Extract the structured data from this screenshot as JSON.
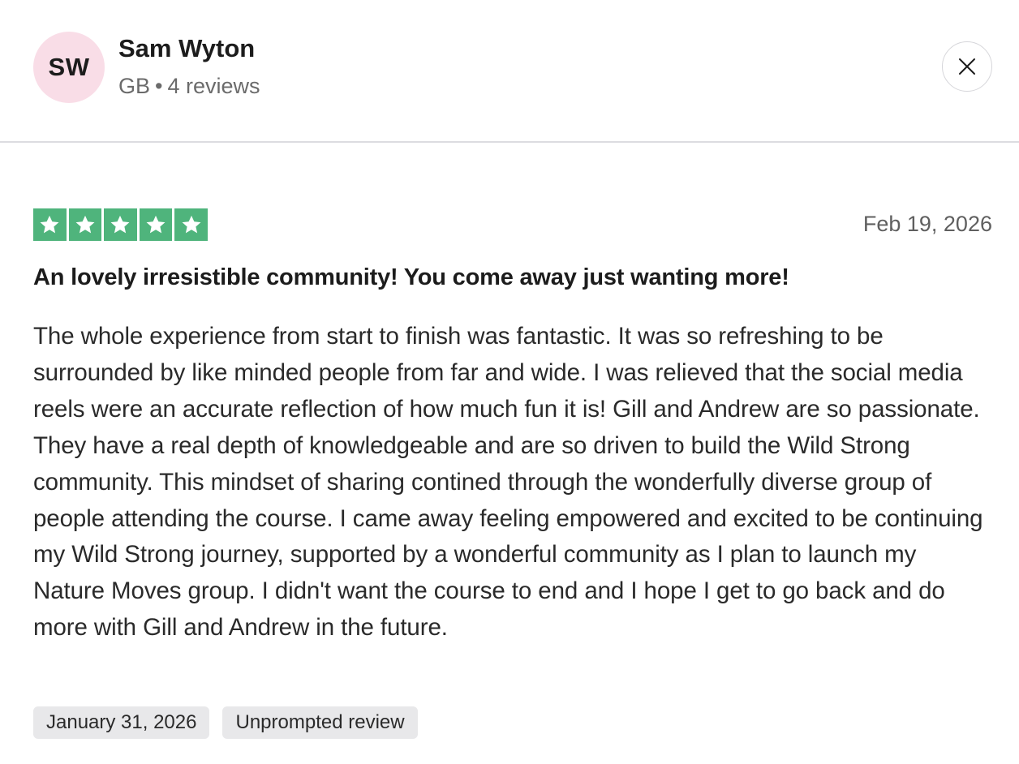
{
  "reviewer": {
    "initials": "SW",
    "name": "Sam Wyton",
    "country": "GB",
    "separator": "•",
    "reviews_count": "4 reviews",
    "avatar_color": "#f9dde7"
  },
  "close_icon": "close-icon",
  "review": {
    "rating": 5,
    "rating_max": 5,
    "star_color": "#4fb47c",
    "date": "Feb 19, 2026",
    "title": "An lovely irresistible community! You come away just wanting more!",
    "body": "The whole experience from start to finish was fantastic. It was so refreshing to be surrounded by like minded people from far and wide. I was relieved that the social media reels were an accurate reflection of how much fun it is! Gill and Andrew are so passionate. They have a real depth of knowledgeable and are so driven to build the Wild Strong community. This mindset of sharing contined through the wonderfully diverse group of people attending the course. I came away feeling empowered and excited to be continuing my Wild Strong journey, supported by a wonderful community as I plan to launch my Nature Moves group. I didn't want the course to end and I hope I get to go back and do more with Gill and Andrew in the future.",
    "tags": [
      "January 31, 2026",
      "Unprompted review"
    ]
  }
}
